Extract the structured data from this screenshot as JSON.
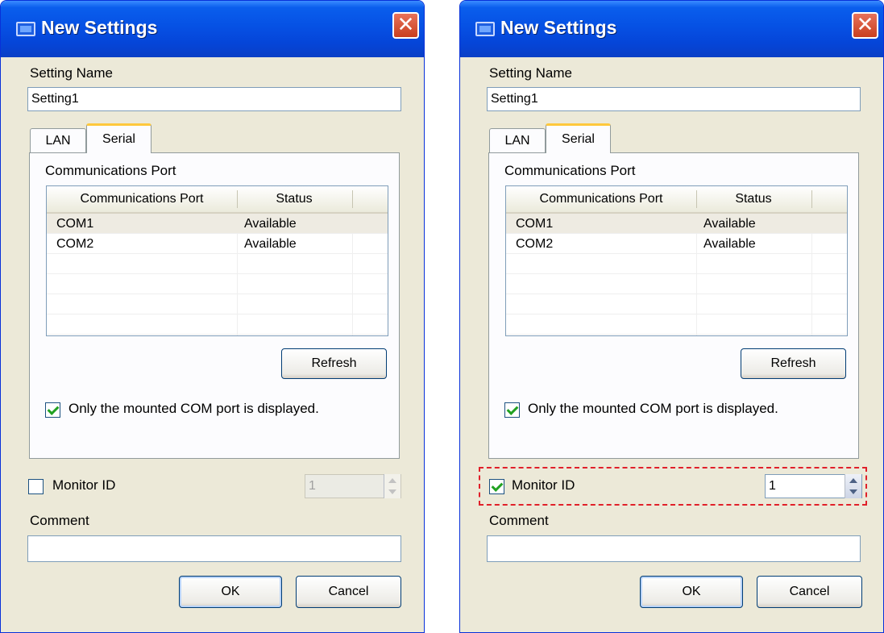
{
  "colors": {
    "titlebar": "#0651e4",
    "dialog_bg": "#ece9d8",
    "check_green": "#21a121",
    "highlight_red": "#e0202a",
    "tab_accent": "#ffc83c"
  },
  "dialogs": [
    {
      "title": "New Settings",
      "close_icon": "close-icon",
      "setting_name_label": "Setting Name",
      "setting_name_value": "Setting1",
      "tabs": [
        {
          "label": "LAN",
          "selected": false
        },
        {
          "label": "Serial",
          "selected": true
        }
      ],
      "comm_port_label": "Communications Port",
      "columns": [
        "Communications Port",
        "Status"
      ],
      "rows": [
        {
          "port": "COM1",
          "status": "Available",
          "selected": true
        },
        {
          "port": "COM2",
          "status": "Available",
          "selected": false
        }
      ],
      "refresh_label": "Refresh",
      "mounted_only_label": "Only the mounted COM port is displayed.",
      "mounted_only_checked": true,
      "monitor_id_label": "Monitor ID",
      "monitor_id_checked": false,
      "monitor_id_value": "1",
      "monitor_id_enabled": false,
      "comment_label": "Comment",
      "comment_value": "",
      "ok_label": "OK",
      "cancel_label": "Cancel"
    },
    {
      "title": "New Settings",
      "close_icon": "close-icon",
      "setting_name_label": "Setting Name",
      "setting_name_value": "Setting1",
      "tabs": [
        {
          "label": "LAN",
          "selected": false
        },
        {
          "label": "Serial",
          "selected": true
        }
      ],
      "comm_port_label": "Communications Port",
      "columns": [
        "Communications Port",
        "Status"
      ],
      "rows": [
        {
          "port": "COM1",
          "status": "Available",
          "selected": true
        },
        {
          "port": "COM2",
          "status": "Available",
          "selected": false
        }
      ],
      "refresh_label": "Refresh",
      "mounted_only_label": "Only the mounted COM port is displayed.",
      "mounted_only_checked": true,
      "monitor_id_label": "Monitor ID",
      "monitor_id_checked": true,
      "monitor_id_value": "1",
      "monitor_id_enabled": true,
      "comment_label": "Comment",
      "comment_value": "",
      "ok_label": "OK",
      "cancel_label": "Cancel"
    }
  ]
}
